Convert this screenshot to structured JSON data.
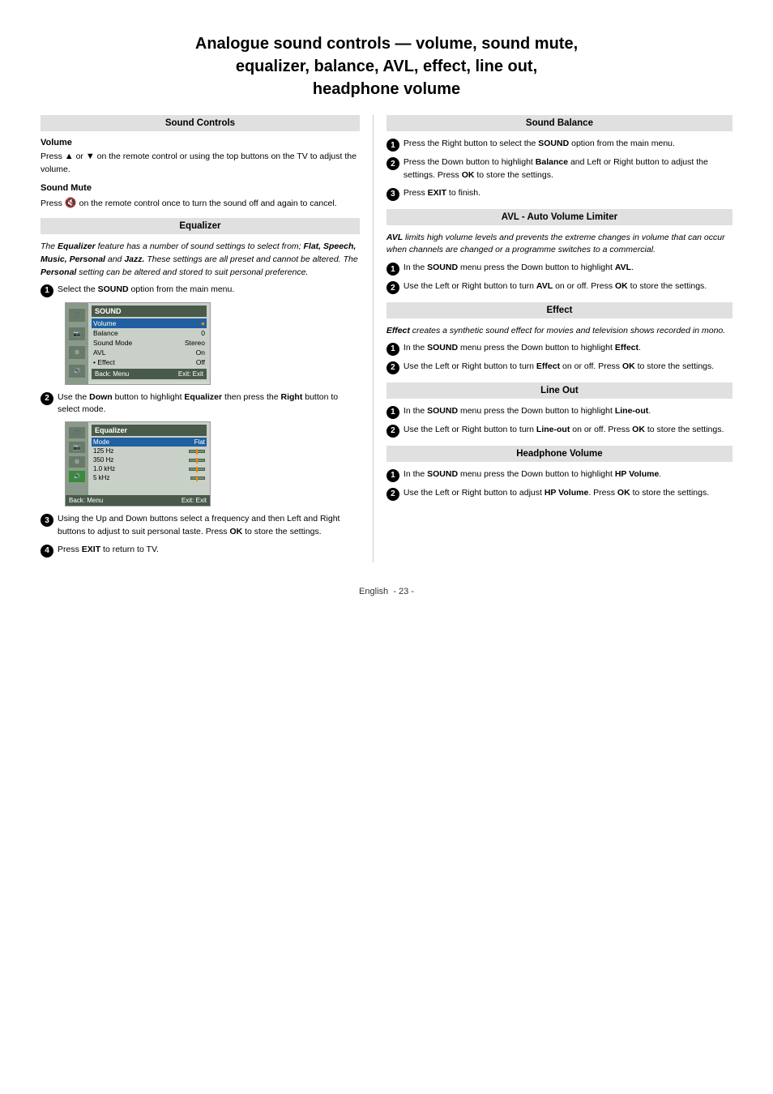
{
  "page": {
    "title_line1": "Analogue sound controls — volume, sound mute,",
    "title_line2": "equalizer, balance, AVL, effect, line out,",
    "title_line3": "headphone  volume"
  },
  "left_col": {
    "section1_header": "Sound Controls",
    "volume_title": "Volume",
    "volume_text": "on the remote control or using the top buttons on the TV to adjust the volume.",
    "volume_prefix": "Press",
    "sound_mute_title": "Sound Mute",
    "sound_mute_text": "on the remote control once to turn the sound off and again to cancel.",
    "sound_mute_prefix": "Press",
    "section2_header": "Equalizer",
    "eq_intro": "The Equalizer feature has a number of sound settings to select from; Flat, Speech, Music, Personal and Jazz. These settings are all preset and cannot be altered. The Personal setting can be altered and stored to suit personal preference.",
    "eq_step1": "Select the SOUND option from the main menu.",
    "eq_step2_pre": "Use the ",
    "eq_step2_bold1": "Down",
    "eq_step2_mid": " button to highlight ",
    "eq_step2_bold2": "Equalizer",
    "eq_step2_end": " then press the ",
    "eq_step2_bold3": "Right",
    "eq_step2_end2": " button to select mode.",
    "eq_step3": "Using the Up and Down buttons select a frequency and then Left and Right buttons to adjust to suit personal taste. Press OK to store the settings.",
    "eq_step3_bold": "OK",
    "eq_step4_pre": "Press ",
    "eq_step4_bold": "EXIT",
    "eq_step4_end": " to return to TV.",
    "menu1": {
      "title": "SOUND",
      "rows": [
        {
          "label": "Volume",
          "value": "",
          "highlighted": true,
          "dot": true
        },
        {
          "label": "Balance",
          "value": "0",
          "highlighted": false
        },
        {
          "label": "Sound Mode",
          "value": "Stereo",
          "highlighted": false
        },
        {
          "label": "AVL",
          "value": "On",
          "highlighted": false
        },
        {
          "label": "• Effect",
          "value": "Off",
          "highlighted": false
        }
      ],
      "footer_left": "Back: Menu",
      "footer_right": "Exit: Exit"
    },
    "menu2": {
      "title": "Equalizer",
      "rows": [
        {
          "label": "Mode",
          "value": "Flat",
          "highlighted": true
        },
        {
          "label": "125 Hz",
          "value": "",
          "bar": true
        },
        {
          "label": "350 Hz",
          "value": "",
          "bar": true
        },
        {
          "label": "1.0 kHz",
          "value": "",
          "bar": true
        },
        {
          "label": "5 kHz",
          "value": "",
          "bar": true
        }
      ],
      "footer_left": "Back: Menu",
      "footer_right": "Exit: Exit"
    }
  },
  "right_col": {
    "section1_header": "Sound Balance",
    "balance_step1_pre": "Press the Right button to select the ",
    "balance_step1_bold": "SOUND",
    "balance_step1_end": " option from the main menu.",
    "balance_step2_pre": "Press the Down button to highlight ",
    "balance_step2_bold": "Balance",
    "balance_step2_end": " and Left or Right button to adjust the settings. Press ",
    "balance_step2_bold2": "OK",
    "balance_step2_end2": " to store the settings.",
    "balance_step3_pre": "Press ",
    "balance_step3_bold": "EXIT",
    "balance_step3_end": " to finish.",
    "section2_header": "AVL - Auto Volume Limiter",
    "avl_intro": "AVL limits high volume levels and prevents the extreme changes in volume that can occur when channels are changed or a programme switches to a commercial.",
    "avl_step1_pre": "In the ",
    "avl_step1_bold": "SOUND",
    "avl_step1_end": " menu press the Down button to highlight AVL.",
    "avl_step1_bold2": "AVL",
    "avl_step2_pre": "Use the Left or Right button to turn ",
    "avl_step2_bold": "AVL",
    "avl_step2_end": " on or off. Press ",
    "avl_step2_bold2": "OK",
    "avl_step2_end2": " to store the settings.",
    "section3_header": "Effect",
    "effect_intro": "Effect creates a synthetic sound effect for movies and television shows recorded in mono.",
    "effect_step1_pre": "In the ",
    "effect_step1_bold": "SOUND",
    "effect_step1_end": " menu press the Down button to highlight ",
    "effect_step1_bold2": "Effect",
    "effect_step1_end2": ".",
    "effect_step2_pre": "Use the Left or Right button to turn ",
    "effect_step2_bold": "Effect",
    "effect_step2_end": " on or off. Press ",
    "effect_step2_bold2": "OK",
    "effect_step2_end2": " to store the settings.",
    "section4_header": "Line Out",
    "lineout_step1_pre": "In the ",
    "lineout_step1_bold": "SOUND",
    "lineout_step1_end": " menu press the Down button to highlight ",
    "lineout_step1_bold2": "Line-out",
    "lineout_step1_end2": ".",
    "lineout_step2_pre": "Use the Left or Right button to turn ",
    "lineout_step2_bold": "Line-out",
    "lineout_step2_end": " on or off. Press ",
    "lineout_step2_bold2": "OK",
    "lineout_step2_end2": " to store the settings.",
    "section5_header": "Headphone Volume",
    "hp_step1_pre": "In the ",
    "hp_step1_bold": "SOUND",
    "hp_step1_end": " menu press the Down button to highlight ",
    "hp_step1_bold2": "HP Volume",
    "hp_step1_end2": ".",
    "hp_step2_pre": "Use the Left or Right button to adjust ",
    "hp_step2_bold": "HP Volume",
    "hp_step2_end": ". Press ",
    "hp_step2_bold2": "OK",
    "hp_step2_end2": " to store the settings."
  },
  "footer": {
    "language": "English",
    "page_number": "- 23 -"
  }
}
